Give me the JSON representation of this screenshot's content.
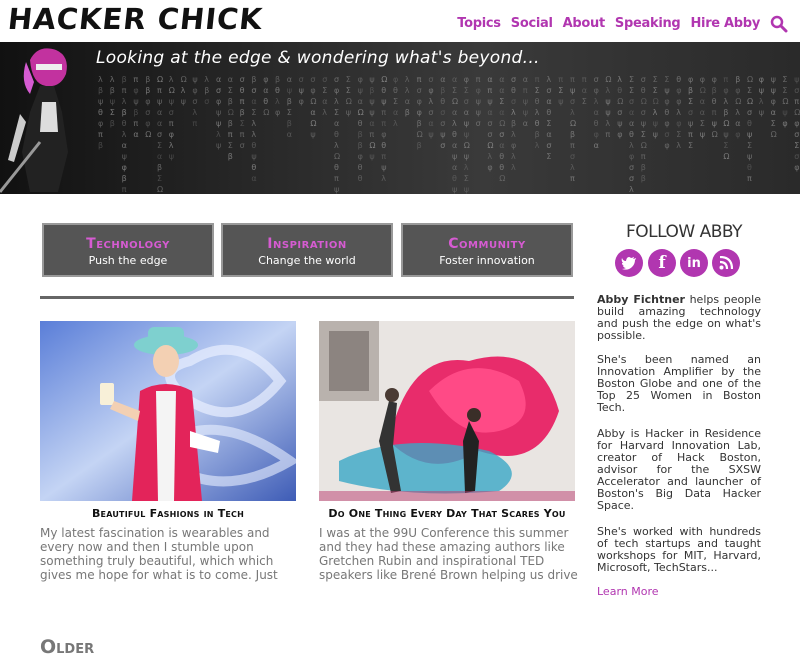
{
  "site": {
    "logo": "HACKER CHICK",
    "nav": [
      "Topics",
      "Social",
      "About",
      "Speaking",
      "Hire Abby"
    ],
    "tagline": "Looking at the edge & wondering what's beyond..."
  },
  "categories": [
    {
      "title": "Technology",
      "sub": "Push the edge"
    },
    {
      "title": "Inspiration",
      "sub": "Change the world"
    },
    {
      "title": "Community",
      "sub": "Foster innovation"
    }
  ],
  "posts": [
    {
      "title": "Beautiful Fashions in Tech",
      "excerpt": "My latest fascination is wearables and every now and then I stumble upon something truly beautiful, which which gives me hope for what is to come. Just wrote this piece as a Tech"
    },
    {
      "title": "Do One Thing Every Day That Scares You",
      "excerpt": "I was at the 99U Conference this summer and they had these amazing authors like Gretchen Rubin and inspirational TED speakers like Brené Brown helping us drive our ideas forward."
    }
  ],
  "older_label": "Older",
  "sidebar": {
    "follow_title": "FOLLOW ABBY",
    "social": [
      "twitter-icon",
      "facebook-icon",
      "linkedin-icon",
      "rss-icon"
    ],
    "bio_name": "Abby Fichtner",
    "bio_1_rest": " helps people build amazing technology and push the edge on what's possible.",
    "bio_2": "She's been named an Innovation Amplifier by the Boston Globe and one of the Top 25 Women in Boston Tech.",
    "bio_3": "Abby is Hacker in Residence for Harvard Innovation Lab, creator of Hack Boston, advisor for the SXSW Accelerator and launcher of Boston's Big Data Hacker Space.",
    "bio_4": "She's worked with hundreds of tech startups and taught workshops for MIT, Harvard, Microsoft, TechStars...",
    "learn_more": "Learn More"
  },
  "colors": {
    "accent": "#b136b0",
    "category_title": "#d65bd2",
    "category_bg": "#555555"
  }
}
